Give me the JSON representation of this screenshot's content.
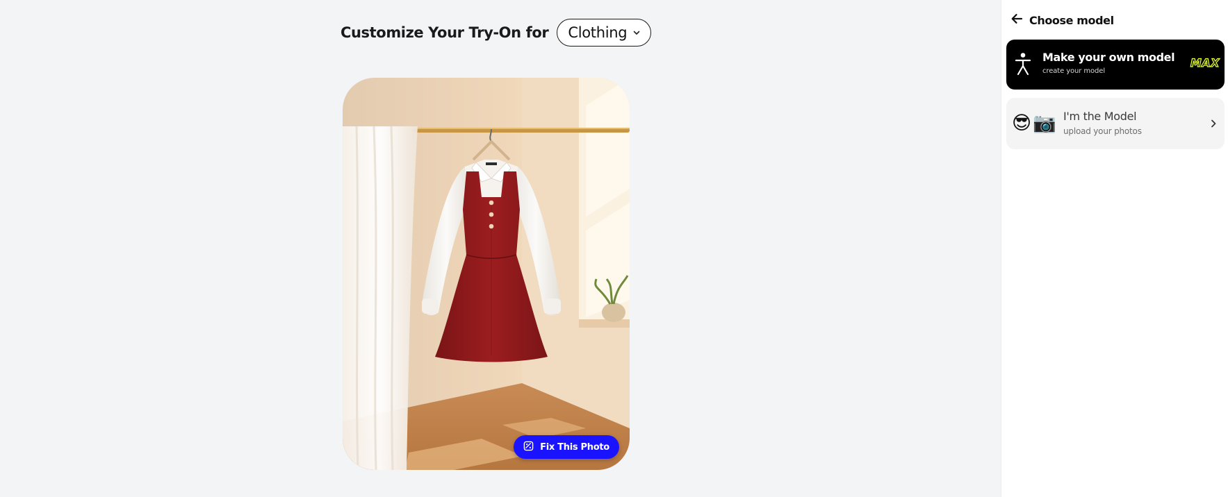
{
  "main": {
    "heading": "Customize Your Try-On for",
    "category_select": {
      "value": "Clothing"
    },
    "photo": {
      "subject": "white-collared blouse with red tweed pinafore dress on hanger"
    },
    "fix_button": {
      "label": "Fix This Photo",
      "icon": "image-fix-icon"
    }
  },
  "panel": {
    "title": "Choose model",
    "back_icon": "arrow-left-icon",
    "options": [
      {
        "title": "Make your own model",
        "subtitle": "create your model",
        "icon": "person-figure-icon",
        "badge": "MAX",
        "selected": true
      },
      {
        "title": "I'm the Model",
        "subtitle": "upload your photos",
        "icon": "sunglasses-camera-emoji",
        "emojis": "😎📷"
      }
    ]
  },
  "colors": {
    "page_bg": "#f3f4f6",
    "panel_bg": "#ffffff",
    "primary_button": "#1a13ff",
    "selected_card": "#000000",
    "badge_outline": "#e6ff2a"
  }
}
